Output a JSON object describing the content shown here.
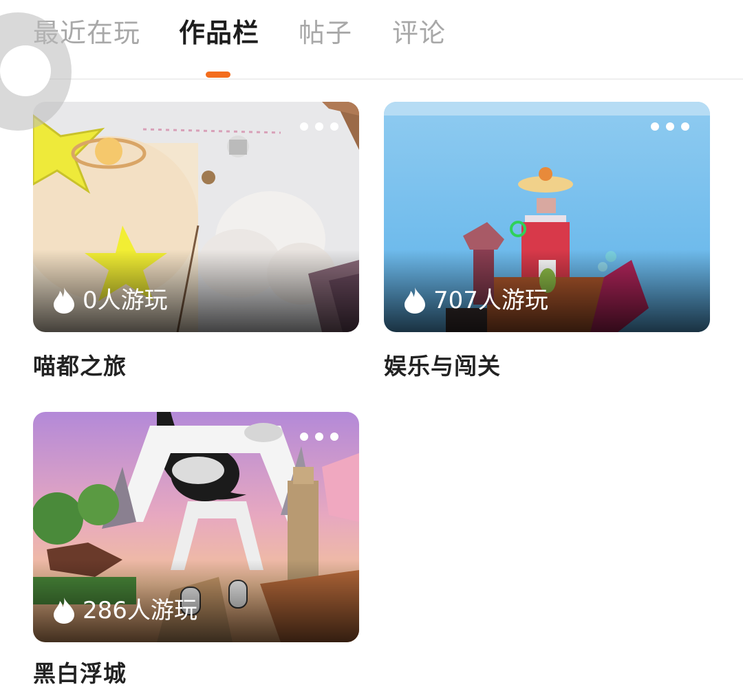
{
  "tabs": [
    {
      "label": "最近在玩",
      "active": false
    },
    {
      "label": "作品栏",
      "active": true
    },
    {
      "label": "帖子",
      "active": false
    },
    {
      "label": "评论",
      "active": false
    }
  ],
  "accent_color": "#f36d1d",
  "works": [
    {
      "title": "喵都之旅",
      "plays": "0人游玩",
      "icon": "fire-icon"
    },
    {
      "title": "娱乐与闯关",
      "plays": "707人游玩",
      "icon": "fire-icon"
    },
    {
      "title": "黑白浮城",
      "plays": "286人游玩",
      "icon": "fire-icon"
    }
  ]
}
